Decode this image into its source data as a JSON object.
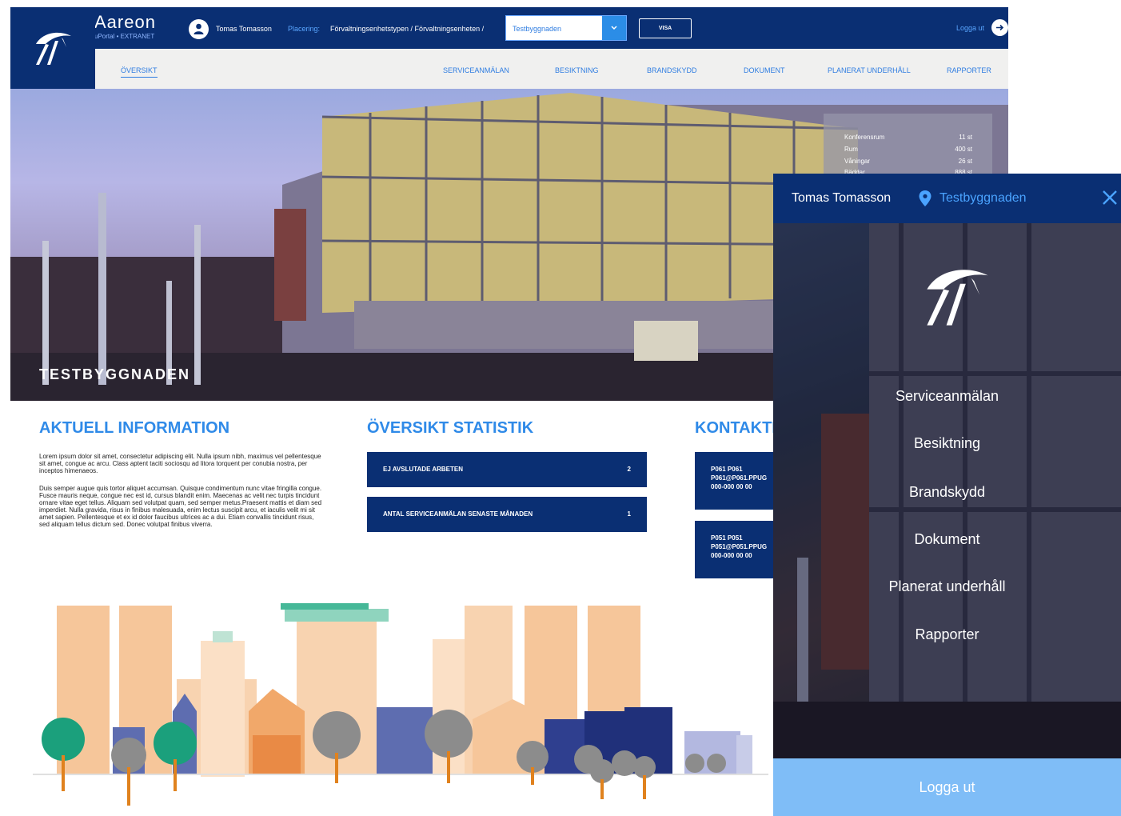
{
  "header": {
    "brand_name": "Aareon",
    "brand_sub": "uPortal • EXTRANET",
    "user_name": "Tomas Tomasson",
    "placering_label": "Placering:",
    "placering_path": "Förvaltningsenhetstypen  /   Förvaltningsenheten /",
    "select_value": "Testbyggnaden",
    "visa_label": "VISA",
    "logout_label": "Logga ut"
  },
  "nav": {
    "items": [
      "ÖVERSIKT",
      "SERVICEANMÄLAN",
      "BESIKTNING",
      "BRANDSKYDD",
      "DOKUMENT",
      "PLANERAT UNDERHÅLL",
      "RAPPORTER"
    ]
  },
  "hero": {
    "title": "TESTBYGGNADEN",
    "stats": [
      {
        "label": "Konferensrum",
        "value": "11 st"
      },
      {
        "label": "Rum",
        "value": "400 st"
      },
      {
        "label": "Våningar",
        "value": "26 st"
      },
      {
        "label": "Bäddar",
        "value": "888 st"
      }
    ]
  },
  "info": {
    "title": "AKTUELL INFORMATION",
    "para1": "Lorem ipsum dolor sit amet, consectetur adipiscing elit. Nulla ipsum nibh, maximus vel pellentesque sit amet, congue ac arcu. Class aptent taciti sociosqu ad litora torquent per conubia nostra, per inceptos himenaeos.",
    "para2": "Duis semper augue quis tortor aliquet accumsan. Quisque condimentum nunc vitae fringilla congue. Fusce mauris neque, congue nec est id, cursus blandit enim. Maecenas ac velit nec turpis tincidunt ornare vitae eget tellus. Aliquam sed volutpat quam, sed semper metus.Praesent mattis et diam sed imperdiet. Nulla gravida, risus in finibus malesuada, enim lectus suscipit arcu, et iaculis velit mi sit amet sapien. Pellentesque et ex id dolor faucibus ultrices ac a dui. Etiam convallis tincidunt risus, sed aliquam tellus dictum sed. Donec volutpat finibus viverra."
  },
  "statistik": {
    "title": "ÖVERSIKT STATISTIK",
    "rows": [
      {
        "label": "EJ AVSLUTADE ARBETEN",
        "value": "2"
      },
      {
        "label": "ANTAL SERVICEANMÄLAN SENASTE MÅNADEN",
        "value": "1"
      }
    ]
  },
  "kontakt": {
    "title": "KONTAKTPERSONER",
    "cards": [
      {
        "name": "P061 P061",
        "email": "P061@P061.PPUG",
        "phone": "000-000 00 00"
      },
      {
        "name": "P051 P051",
        "email": "P051@P051.PPUG",
        "phone": "000-000 00 00"
      }
    ]
  },
  "mobile": {
    "user_name": "Tomas Tomasson",
    "location": "Testbyggnaden",
    "menu": [
      "Serviceanmälan",
      "Besiktning",
      "Brandskydd",
      "Dokument",
      "Planerat underhåll",
      "Rapporter"
    ],
    "logout_label": "Logga ut"
  },
  "colors": {
    "navy": "#0a2f73",
    "accent_blue": "#2f8ae8",
    "mobile_logout": "#7fbdf7"
  }
}
